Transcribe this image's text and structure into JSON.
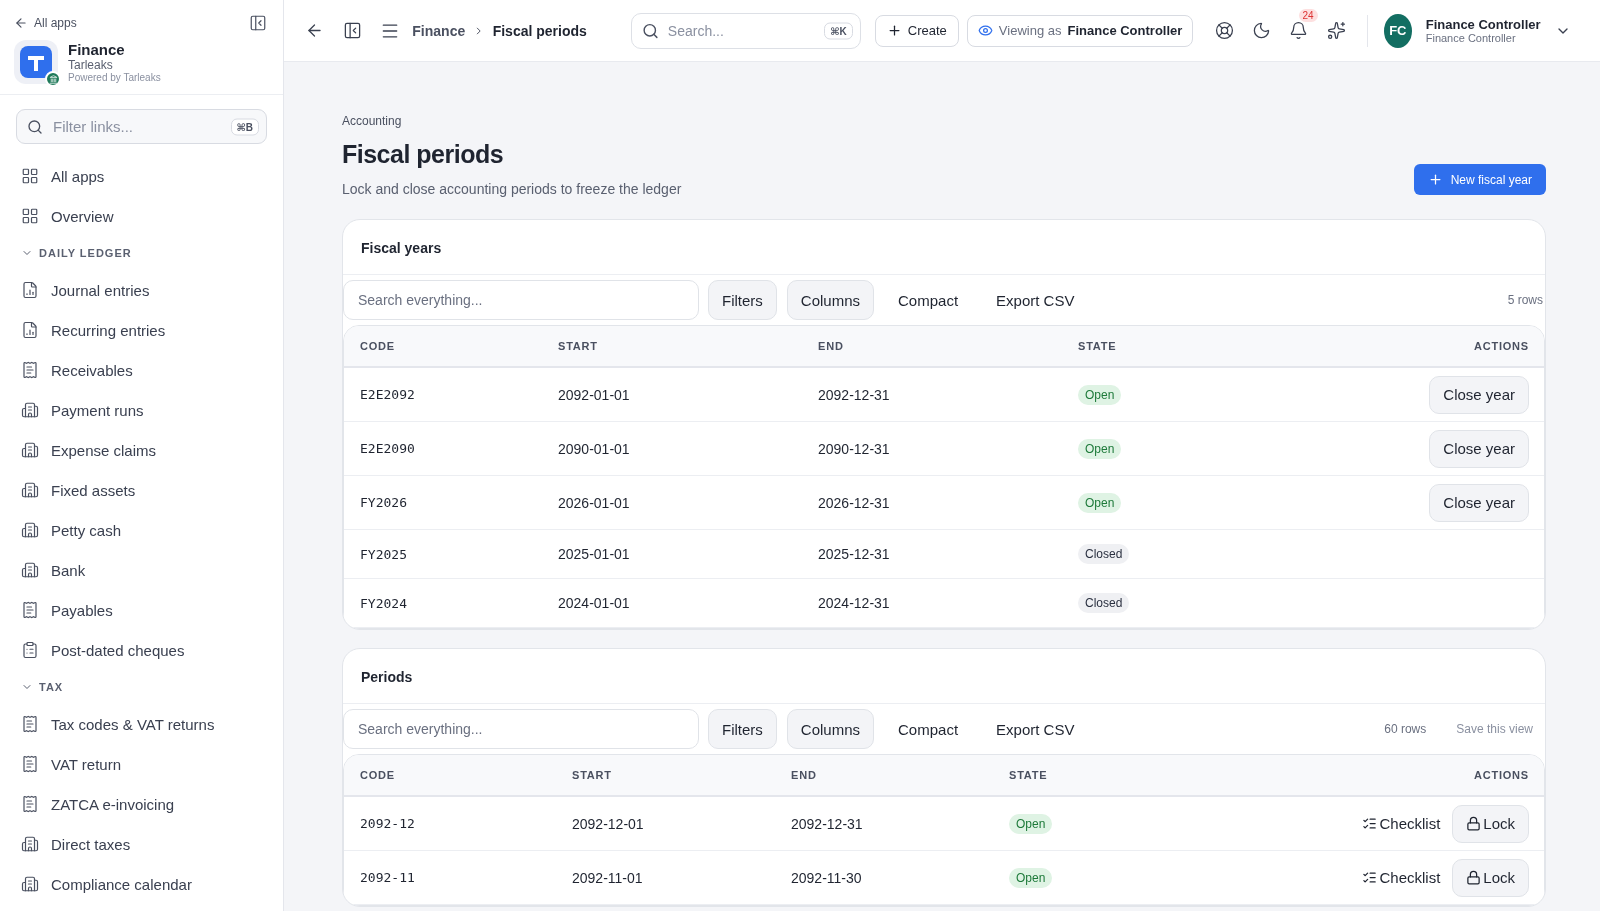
{
  "sidebar": {
    "back_link": "All apps",
    "app": {
      "name": "Finance",
      "org": "Tarleaks",
      "powered_by": "Powered by Tarleaks"
    },
    "filter": {
      "placeholder": "Filter links...",
      "shortcut": "⌘B"
    },
    "top_items": [
      {
        "label": "All apps",
        "kind": "grid"
      },
      {
        "label": "Overview",
        "kind": "grid"
      }
    ],
    "sections": [
      {
        "title": "DAILY LEDGER",
        "expanded": true,
        "items": [
          {
            "label": "Journal entries",
            "kind": "report"
          },
          {
            "label": "Recurring entries",
            "kind": "report"
          },
          {
            "label": "Receivables",
            "kind": "dollar"
          },
          {
            "label": "Payment runs",
            "kind": "building"
          },
          {
            "label": "Expense claims",
            "kind": "building"
          },
          {
            "label": "Fixed assets",
            "kind": "building"
          },
          {
            "label": "Petty cash",
            "kind": "building"
          },
          {
            "label": "Bank",
            "kind": "building"
          },
          {
            "label": "Payables",
            "kind": "dollar"
          },
          {
            "label": "Post-dated cheques",
            "kind": "clipboard"
          }
        ]
      },
      {
        "title": "TAX",
        "expanded": true,
        "items": [
          {
            "label": "Tax codes & VAT returns",
            "kind": "dollar"
          },
          {
            "label": "VAT return",
            "kind": "dollar"
          },
          {
            "label": "ZATCA e-invoicing",
            "kind": "dollar"
          },
          {
            "label": "Direct taxes",
            "kind": "building"
          },
          {
            "label": "Compliance calendar",
            "kind": "building"
          }
        ]
      }
    ]
  },
  "topbar": {
    "breadcrumb": [
      "Finance",
      "Fiscal periods"
    ],
    "search": {
      "placeholder": "Search...",
      "shortcut": "⌘K"
    },
    "create": "Create",
    "viewing_label": "Viewing as",
    "viewing_role": "Finance Controller",
    "notifications": "24",
    "user": {
      "initials": "FC",
      "name": "Finance Controller",
      "role": "Finance Controller"
    }
  },
  "page": {
    "eyebrow": "Accounting",
    "title": "Fiscal periods",
    "subtitle": "Lock and close accounting periods to freeze the ledger",
    "primary_action": "New fiscal year"
  },
  "fiscal_years": {
    "title": "Fiscal years",
    "search": {
      "placeholder": "Search everything..."
    },
    "tools": [
      "Filters",
      "Columns",
      "Compact",
      "Export CSV"
    ],
    "count": "5 rows",
    "columns": [
      "CODE",
      "START",
      "END",
      "STATE",
      "ACTIONS"
    ],
    "rows": [
      {
        "code": "E2E2092",
        "start": "2092-01-01",
        "end": "2092-12-31",
        "state": {
          "label": "Open",
          "kind": "open"
        },
        "action": "Close year"
      },
      {
        "code": "E2E2090",
        "start": "2090-01-01",
        "end": "2090-12-31",
        "state": {
          "label": "Open",
          "kind": "open"
        },
        "action": "Close year"
      },
      {
        "code": "FY2026",
        "start": "2026-01-01",
        "end": "2026-12-31",
        "state": {
          "label": "Open",
          "kind": "open"
        },
        "action": "Close year"
      },
      {
        "code": "FY2025",
        "start": "2025-01-01",
        "end": "2025-12-31",
        "state": {
          "label": "Closed",
          "kind": "closed"
        }
      },
      {
        "code": "FY2024",
        "start": "2024-01-01",
        "end": "2024-12-31",
        "state": {
          "label": "Closed",
          "kind": "closed"
        }
      }
    ]
  },
  "periods": {
    "title": "Periods",
    "search": {
      "placeholder": "Search everything..."
    },
    "tools": [
      "Filters",
      "Columns",
      "Compact",
      "Export CSV"
    ],
    "count": "60 rows",
    "save_view": "Save this view",
    "columns": [
      "CODE",
      "START",
      "END",
      "STATE",
      "ACTIONS"
    ],
    "rows": [
      {
        "code": "2092-12",
        "start": "2092-12-01",
        "end": "2092-12-31",
        "state": {
          "label": "Open",
          "kind": "open"
        },
        "checklist": "Checklist",
        "lock": "Lock"
      },
      {
        "code": "2092-11",
        "start": "2092-11-01",
        "end": "2092-11-30",
        "state": {
          "label": "Open",
          "kind": "open"
        },
        "checklist": "Checklist",
        "lock": "Lock"
      }
    ]
  }
}
